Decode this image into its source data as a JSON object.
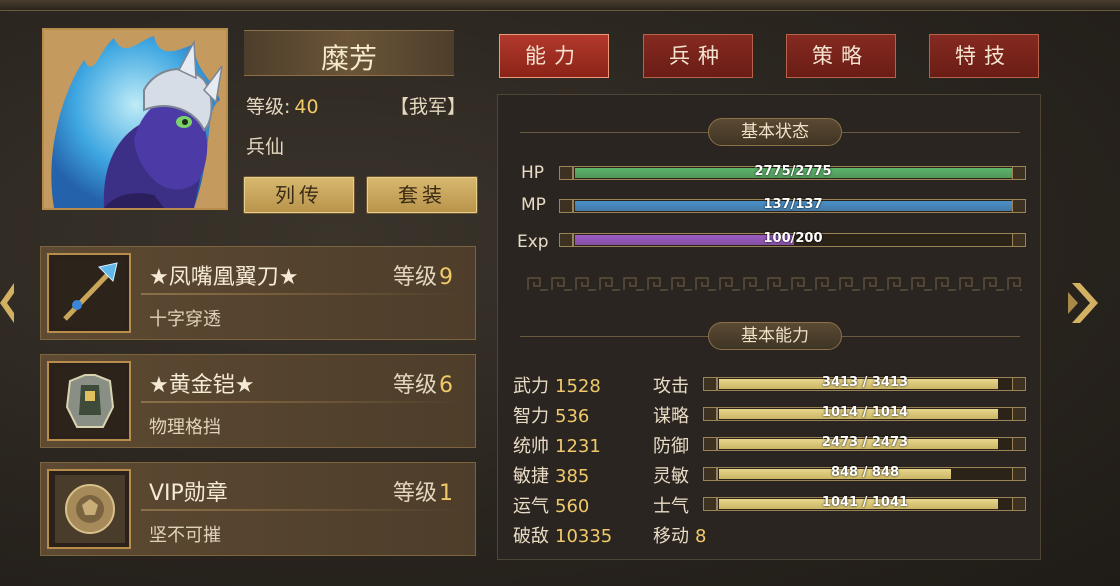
{
  "character": {
    "name": "糜芳",
    "level_label": "等级:",
    "level": "40",
    "army": "【我军】",
    "class": "兵仙",
    "buttons": {
      "biography": "列传",
      "set": "套装"
    }
  },
  "equipment": [
    {
      "name": "★凤嘴凰翼刀★",
      "level_label": "等级",
      "level": "9",
      "desc": "十字穿透",
      "icon": "blade-icon"
    },
    {
      "name": "★黄金铠★",
      "level_label": "等级",
      "level": "6",
      "desc": "物理格挡",
      "icon": "armor-icon"
    },
    {
      "name": "VIP勋章",
      "level_label": "等级",
      "level": "1",
      "desc": "坚不可摧",
      "icon": "medal-icon"
    }
  ],
  "tabs": [
    {
      "label": "能力",
      "active": true
    },
    {
      "label": "兵种",
      "active": false
    },
    {
      "label": "策略",
      "active": false
    },
    {
      "label": "特技",
      "active": false
    }
  ],
  "basic_status": {
    "title": "基本状态",
    "bars": [
      {
        "label": "HP",
        "current": 2775,
        "max": 2775,
        "text": "2775/2775",
        "color": "#5cb36a"
      },
      {
        "label": "MP",
        "current": 137,
        "max": 137,
        "text": "137/137",
        "color": "#4a8fc8"
      },
      {
        "label": "Exp",
        "current": 100,
        "max": 200,
        "text": "100/200",
        "color": "#9a5cc4"
      }
    ]
  },
  "basic_ability": {
    "title": "基本能力",
    "attributes": [
      {
        "label": "武力",
        "value": "1528"
      },
      {
        "label": "智力",
        "value": "536"
      },
      {
        "label": "统帅",
        "value": "1231"
      },
      {
        "label": "敏捷",
        "value": "385"
      },
      {
        "label": "运气",
        "value": "560"
      },
      {
        "label": "破敌",
        "value": "10335"
      }
    ],
    "combat": [
      {
        "label": "攻击",
        "current": 3413,
        "max": 3413,
        "text": "3413 / 3413"
      },
      {
        "label": "谋略",
        "current": 1014,
        "max": 1014,
        "text": "1014 / 1014"
      },
      {
        "label": "防御",
        "current": 2473,
        "max": 2473,
        "text": "2473 / 2473"
      },
      {
        "label": "灵敏",
        "current": 848,
        "max": 848,
        "text": "848 / 848",
        "fill_ratio": 0.83
      },
      {
        "label": "士气",
        "current": 1041,
        "max": 1041,
        "text": "1041 / 1041"
      }
    ],
    "move": {
      "label": "移动",
      "value": "8"
    }
  },
  "colors": {
    "gold_bar": "#e8d68c",
    "accent_gold": "#f0c96a",
    "tab_red": "#a3302a"
  }
}
